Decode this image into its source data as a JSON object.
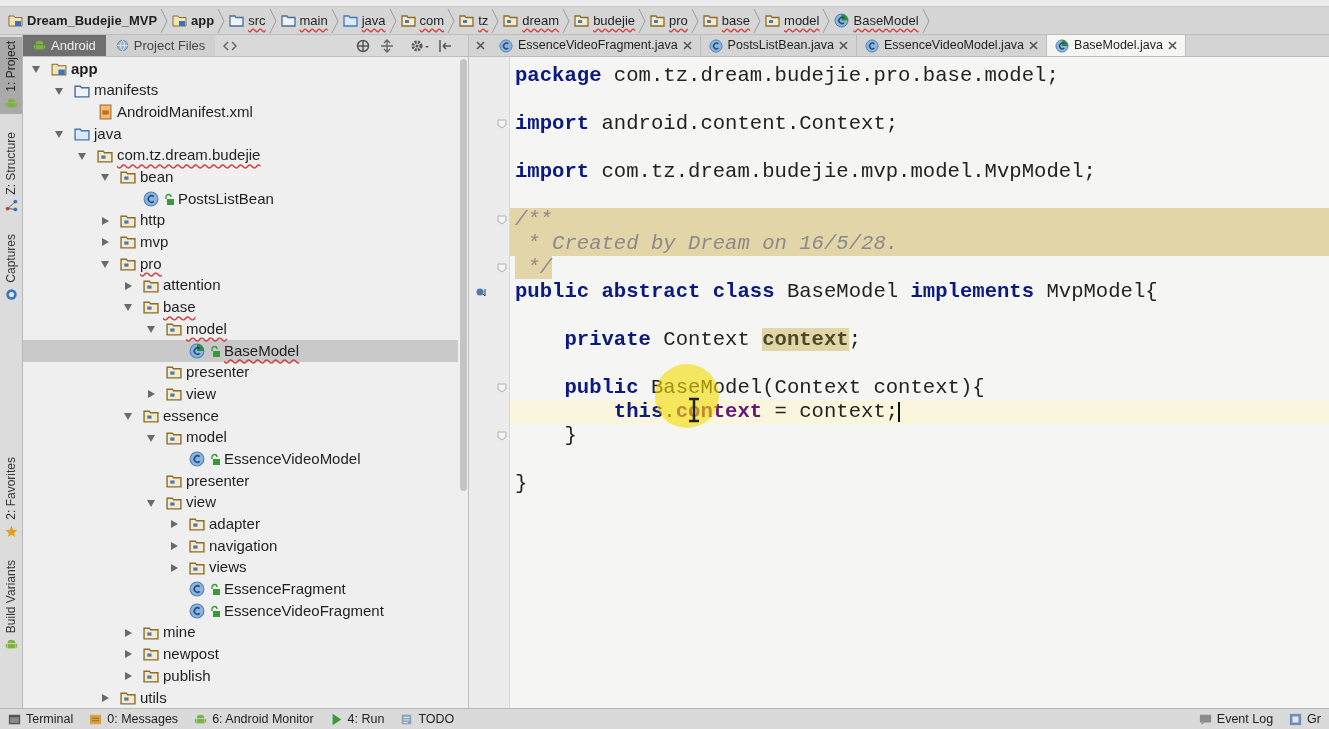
{
  "breadcrumbs": [
    {
      "label": "Dream_Budejie_MVP",
      "kind": "module",
      "misspelled": false
    },
    {
      "label": "app",
      "kind": "module",
      "misspelled": false
    },
    {
      "label": "src",
      "kind": "folder",
      "misspelled": true
    },
    {
      "label": "main",
      "kind": "folder",
      "misspelled": true
    },
    {
      "label": "java",
      "kind": "source-folder",
      "misspelled": true
    },
    {
      "label": "com",
      "kind": "package",
      "misspelled": true
    },
    {
      "label": "tz",
      "kind": "package",
      "misspelled": true
    },
    {
      "label": "dream",
      "kind": "package",
      "misspelled": true
    },
    {
      "label": "budejie",
      "kind": "package",
      "misspelled": true
    },
    {
      "label": "pro",
      "kind": "package",
      "misspelled": true
    },
    {
      "label": "base",
      "kind": "package",
      "misspelled": true
    },
    {
      "label": "model",
      "kind": "package",
      "misspelled": true
    },
    {
      "label": "BaseModel",
      "kind": "abstract-class",
      "misspelled": true
    }
  ],
  "tool_windows": [
    {
      "label": "1: Project",
      "kind": "android",
      "selected": true
    },
    {
      "label": "Z: Structure",
      "kind": "structure",
      "selected": false
    },
    {
      "label": "Captures",
      "kind": "capture",
      "selected": false
    },
    {
      "label": "2: Favorites",
      "kind": "star",
      "selected": false
    },
    {
      "label": "Build Variants",
      "kind": "android",
      "selected": false
    }
  ],
  "project_panel": {
    "views": [
      {
        "label": "Android",
        "kind": "android",
        "selected": true
      },
      {
        "label": "Project Files",
        "kind": "globe",
        "selected": false
      }
    ],
    "tree": [
      {
        "label": "app",
        "kind": "module",
        "expanded": true,
        "selected": false,
        "misspelled": false,
        "children": [
          {
            "label": "manifests",
            "kind": "folder",
            "expanded": true,
            "selected": false,
            "misspelled": false,
            "children": [
              {
                "label": "AndroidManifest.xml",
                "kind": "manifest",
                "selected": false,
                "misspelled": false
              }
            ]
          },
          {
            "label": "java",
            "kind": "source-folder",
            "expanded": true,
            "selected": false,
            "misspelled": false,
            "children": [
              {
                "label": "com.tz.dream.budejie",
                "kind": "package",
                "expanded": true,
                "selected": false,
                "misspelled": true,
                "children": [
                  {
                    "label": "bean",
                    "kind": "package",
                    "expanded": true,
                    "selected": false,
                    "misspelled": false,
                    "children": [
                      {
                        "label": "PostsListBean",
                        "kind": "class",
                        "selected": false,
                        "misspelled": false
                      }
                    ]
                  },
                  {
                    "label": "http",
                    "kind": "package",
                    "expanded": false,
                    "selected": false,
                    "misspelled": false
                  },
                  {
                    "label": "mvp",
                    "kind": "package",
                    "expanded": false,
                    "selected": false,
                    "misspelled": false
                  },
                  {
                    "label": "pro",
                    "kind": "package",
                    "expanded": true,
                    "selected": false,
                    "misspelled": true,
                    "children": [
                      {
                        "label": "attention",
                        "kind": "package",
                        "expanded": false,
                        "selected": false,
                        "misspelled": false
                      },
                      {
                        "label": "base",
                        "kind": "package",
                        "expanded": true,
                        "selected": false,
                        "misspelled": true,
                        "children": [
                          {
                            "label": "model",
                            "kind": "package",
                            "expanded": true,
                            "selected": false,
                            "misspelled": true,
                            "children": [
                              {
                                "label": "BaseModel",
                                "kind": "abstract-class",
                                "selected": true,
                                "misspelled": true
                              }
                            ]
                          },
                          {
                            "label": "presenter",
                            "kind": "package",
                            "selected": false,
                            "misspelled": false
                          },
                          {
                            "label": "view",
                            "kind": "package",
                            "expanded": false,
                            "selected": false,
                            "misspelled": false
                          }
                        ]
                      },
                      {
                        "label": "essence",
                        "kind": "package",
                        "expanded": true,
                        "selected": false,
                        "misspelled": false,
                        "children": [
                          {
                            "label": "model",
                            "kind": "package",
                            "expanded": true,
                            "selected": false,
                            "misspelled": false,
                            "children": [
                              {
                                "label": "EssenceVideoModel",
                                "kind": "class",
                                "selected": false,
                                "misspelled": false
                              }
                            ]
                          },
                          {
                            "label": "presenter",
                            "kind": "package",
                            "selected": false,
                            "misspelled": false
                          },
                          {
                            "label": "view",
                            "kind": "package",
                            "expanded": true,
                            "selected": false,
                            "misspelled": false,
                            "children": [
                              {
                                "label": "adapter",
                                "kind": "package",
                                "expanded": false,
                                "selected": false,
                                "misspelled": false
                              },
                              {
                                "label": "navigation",
                                "kind": "package",
                                "expanded": false,
                                "selected": false,
                                "misspelled": false
                              },
                              {
                                "label": "views",
                                "kind": "package",
                                "expanded": false,
                                "selected": false,
                                "misspelled": false
                              },
                              {
                                "label": "EssenceFragment",
                                "kind": "class",
                                "selected": false,
                                "misspelled": false
                              },
                              {
                                "label": "EssenceVideoFragment",
                                "kind": "class",
                                "selected": false,
                                "misspelled": false
                              }
                            ]
                          }
                        ]
                      },
                      {
                        "label": "mine",
                        "kind": "package",
                        "expanded": false,
                        "selected": false,
                        "misspelled": false
                      },
                      {
                        "label": "newpost",
                        "kind": "package",
                        "expanded": false,
                        "selected": false,
                        "misspelled": false
                      },
                      {
                        "label": "publish",
                        "kind": "package",
                        "expanded": false,
                        "selected": false,
                        "misspelled": false
                      }
                    ]
                  },
                  {
                    "label": "utils",
                    "kind": "package",
                    "expanded": false,
                    "selected": false,
                    "misspelled": false
                  }
                ]
              }
            ]
          }
        ]
      }
    ]
  },
  "editor_tabs": [
    {
      "label": "EssenceVideoFragment.java",
      "kind": "class",
      "selected": false
    },
    {
      "label": "PostsListBean.java",
      "kind": "class",
      "selected": false
    },
    {
      "label": "EssenceVideoModel.java",
      "kind": "class",
      "selected": false
    },
    {
      "label": "BaseModel.java",
      "kind": "abstract-class",
      "selected": true
    }
  ],
  "code_lines": [
    {
      "current": false,
      "band": false,
      "tokens": [
        {
          "text": "package",
          "kind": "keyword"
        },
        {
          "text": " com.tz.dream.budejie.pro.base.model;",
          "kind": "plain"
        }
      ]
    },
    {
      "current": false,
      "band": false
    },
    {
      "current": false,
      "band": false,
      "kind": "fold",
      "tokens": [
        {
          "text": "import",
          "kind": "keyword"
        },
        {
          "text": " android.content.Context;",
          "kind": "plain"
        }
      ]
    },
    {
      "current": false,
      "band": false
    },
    {
      "current": false,
      "band": false,
      "tokens": [
        {
          "text": "import",
          "kind": "keyword"
        },
        {
          "text": " com.tz.dream.budejie.mvp.model.MvpModel;",
          "kind": "plain"
        }
      ]
    },
    {
      "current": false,
      "band": false
    },
    {
      "current": false,
      "band": true,
      "kind": "fold",
      "tokens": [
        {
          "text": "/**",
          "kind": "comment"
        }
      ]
    },
    {
      "current": false,
      "band": true,
      "tokens": [
        {
          "text": " * Created by Dream on 16/5/28.",
          "kind": "comment"
        }
      ]
    },
    {
      "current": false,
      "band": false,
      "kind": "fold",
      "tokens": [
        {
          "text": " */",
          "kind": "comment-marked"
        }
      ]
    },
    {
      "current": false,
      "band": false,
      "kind": "implements",
      "tokens": [
        {
          "text": "public abstract class",
          "kind": "keyword"
        },
        {
          "text": " BaseModel ",
          "kind": "plain"
        },
        {
          "text": "implements",
          "kind": "keyword"
        },
        {
          "text": " MvpModel{",
          "kind": "plain"
        }
      ]
    },
    {
      "current": false,
      "band": false
    },
    {
      "current": false,
      "band": false,
      "tokens": [
        {
          "text": "    private",
          "kind": "keyword"
        },
        {
          "text": " Context ",
          "kind": "plain"
        },
        {
          "text": "context",
          "kind": "field-marked"
        },
        {
          "text": ";",
          "kind": "plain"
        }
      ]
    },
    {
      "current": false,
      "band": false
    },
    {
      "current": false,
      "band": false,
      "kind": "fold",
      "tokens": [
        {
          "text": "    public",
          "kind": "keyword"
        },
        {
          "text": " BaseModel(Context context){",
          "kind": "plain"
        }
      ]
    },
    {
      "current": true,
      "band": false,
      "tokens": [
        {
          "text": "        this",
          "kind": "keyword"
        },
        {
          "text": ".",
          "kind": "plain"
        },
        {
          "text": "context",
          "kind": "field"
        },
        {
          "text": " = context;",
          "kind": "plain"
        }
      ]
    },
    {
      "current": false,
      "band": false,
      "kind": "fold",
      "tokens": [
        {
          "text": "    }",
          "kind": "plain"
        }
      ]
    },
    {
      "current": false,
      "band": false
    },
    {
      "current": false,
      "band": false,
      "tokens": [
        {
          "text": "}",
          "kind": "plain"
        }
      ]
    }
  ],
  "status_bar": {
    "left": [
      {
        "label": "Terminal",
        "kind": "terminal"
      },
      {
        "label": "0: Messages",
        "kind": "messages"
      },
      {
        "label": "6: Android Monitor",
        "kind": "android"
      },
      {
        "label": "4: Run",
        "kind": "run"
      },
      {
        "label": "TODO",
        "kind": "todo"
      }
    ],
    "right": [
      {
        "label": "Event Log",
        "kind": "log"
      },
      {
        "label": "Gr",
        "kind": "gradle"
      }
    ]
  }
}
